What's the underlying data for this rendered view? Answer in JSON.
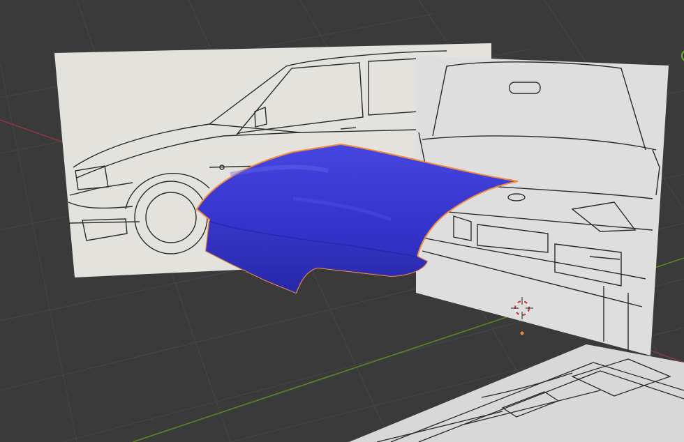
{
  "viewport": {
    "mode": "3D Viewport",
    "background_color": "#3a3a3a",
    "grid_color": "#474747",
    "x_axis_color": "#8a3a40",
    "y_axis_color": "#5c8a2a"
  },
  "objects": {
    "side_reference": {
      "name": "side-reference-image",
      "color": "#e4e2dc",
      "line_color": "#2a2a2a"
    },
    "front_reference": {
      "name": "front-reference-image",
      "color": "#dedede",
      "line_color": "#2a2a2a"
    },
    "top_reference": {
      "name": "top-reference-image",
      "color": "#d8d8d8",
      "line_color": "#2a2a2a"
    },
    "hood_mesh": {
      "name": "hood-mesh",
      "color": "#3a3ad0",
      "outline_color": "#f08a40",
      "selected": true
    }
  },
  "cursor": {
    "name": "3d-cursor-icon"
  },
  "origin": {
    "name": "object-origin-dot",
    "color": "#f08a40"
  }
}
